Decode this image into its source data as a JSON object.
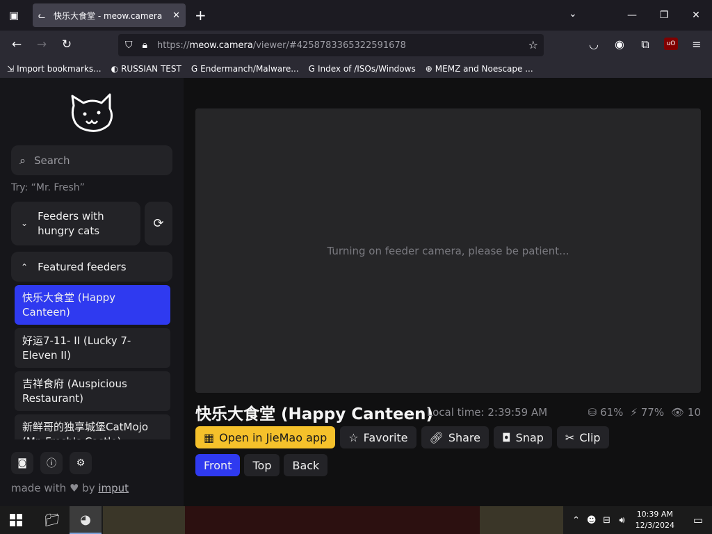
{
  "browser": {
    "tab_title": "快乐大食堂 - meow.camera",
    "url_prefix": "https://",
    "url_host": "meow.camera",
    "url_path": "/viewer/#4258783365322591678",
    "bookmarks": [
      {
        "label": "Import bookmarks..."
      },
      {
        "label": "RUSSIAN TEST"
      },
      {
        "label": "Endermanch/Malware..."
      },
      {
        "label": "Index of /ISOs/Windows"
      },
      {
        "label": "MEMZ and Noescape ..."
      }
    ]
  },
  "sidebar": {
    "search_placeholder": "Search",
    "try_hint": "Try: “Mr. Fresh”",
    "hungry_group": "Feeders with hungry cats",
    "featured_group": "Featured feeders",
    "feeders": [
      {
        "name": "快乐大食堂 (Happy Canteen)"
      },
      {
        "name": "好运7-11- II  (Lucky 7-Eleven II)"
      },
      {
        "name": "吉祥食府 (Auspicious Restaurant)"
      },
      {
        "name": "新鲜哥的独享城堡CatMojo (Mr. Fresh's Castle)"
      }
    ],
    "made_with_prefix": "made with",
    "made_with_by": "by",
    "made_with_author": "imput"
  },
  "viewer": {
    "loading_text": "Turning on feeder camera, please be patient...",
    "feeder_title": "快乐大食堂 (Happy Canteen)",
    "local_time": "Local time: 2:39:59 AM",
    "food_level": "61%",
    "battery_level": "77%",
    "viewers": "10",
    "actions": [
      {
        "label": "Open in JieMao app"
      },
      {
        "label": "Favorite"
      },
      {
        "label": "Share"
      },
      {
        "label": "Snap"
      },
      {
        "label": "Clip"
      }
    ],
    "views": [
      {
        "label": "Front"
      },
      {
        "label": "Top"
      },
      {
        "label": "Back"
      }
    ]
  },
  "taskbar": {
    "time": "10:39 AM",
    "date": "12/3/2024"
  },
  "colors": {
    "accent_blue": "#2f3af0",
    "accent_yellow": "#f5c12b"
  }
}
